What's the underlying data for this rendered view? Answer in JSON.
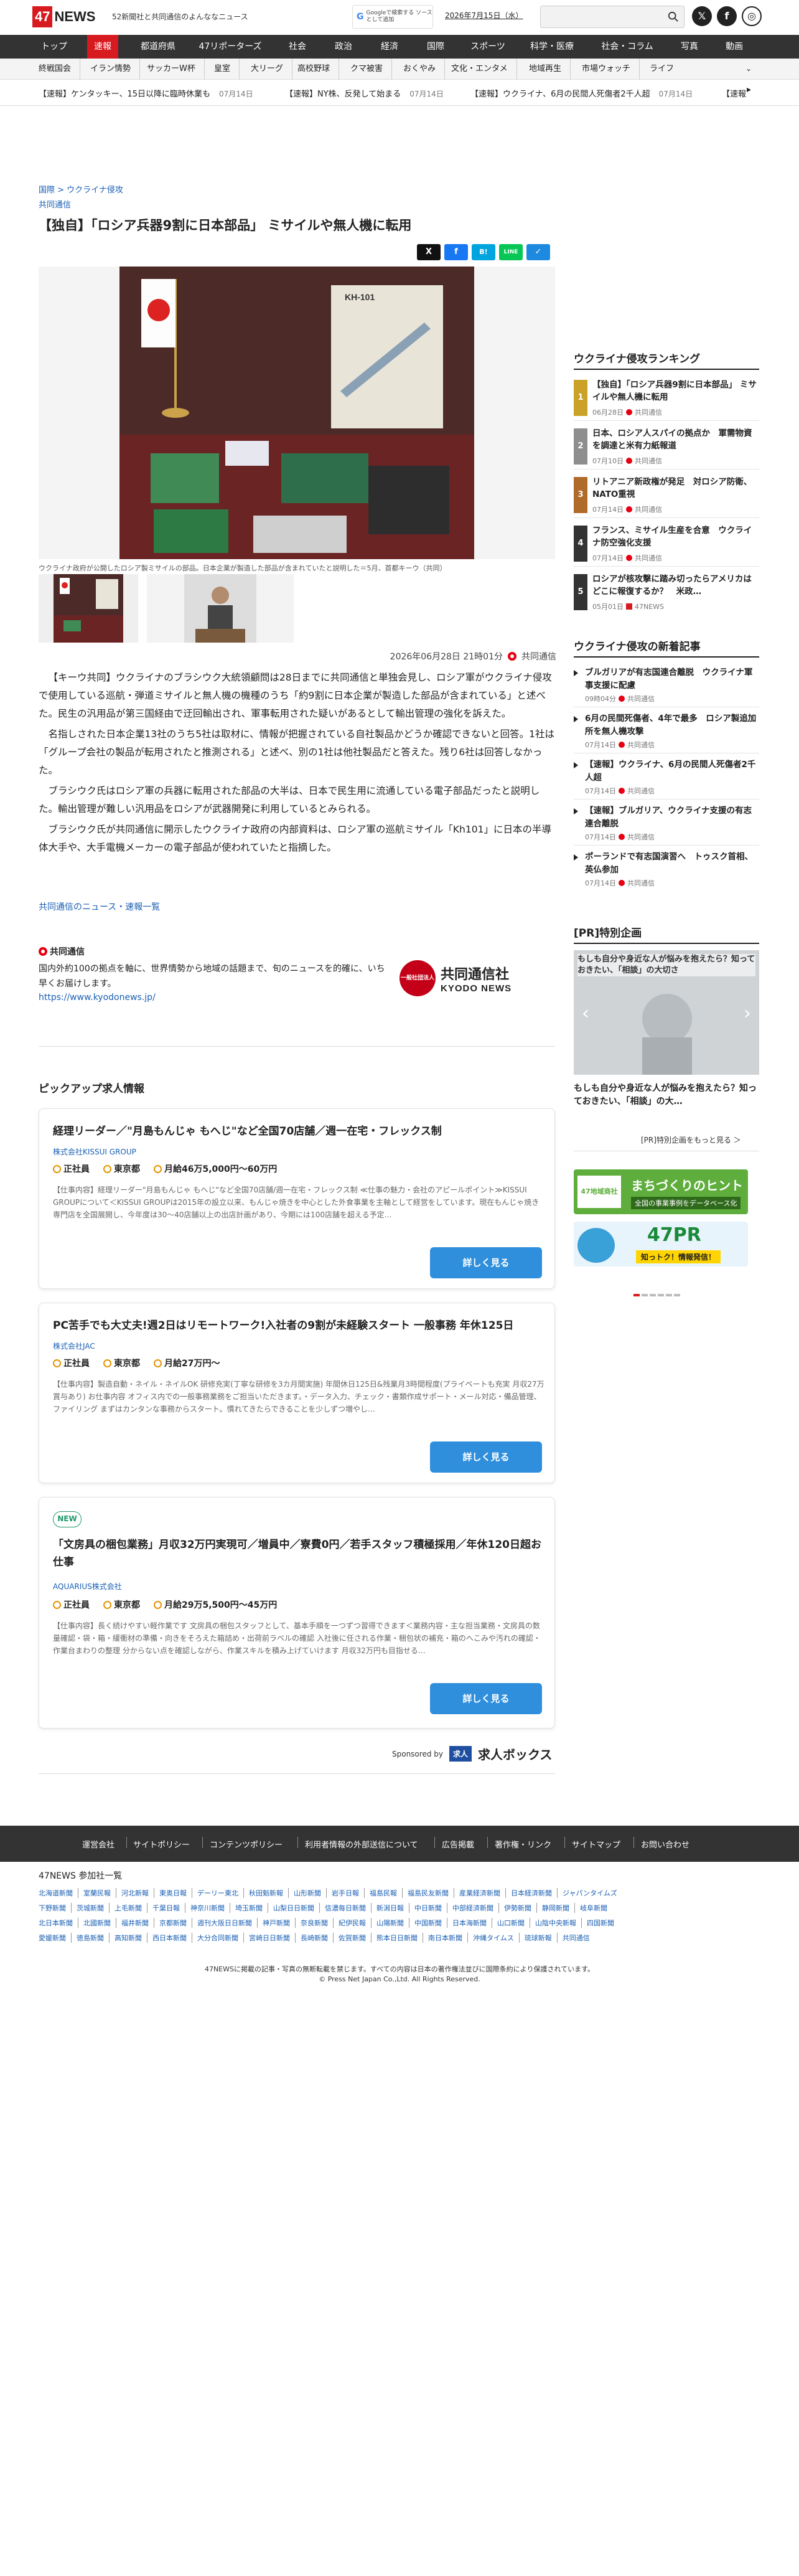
{
  "site": {
    "logo_num": "47",
    "logo_news": "NEWS",
    "tagline": "52新聞社と共同通信のよんななニュース",
    "google_label": "Googleで検索する ソースとして追加",
    "date": "2026年7月15日（水）",
    "search_placeholder": ""
  },
  "nav_main": [
    "トップ",
    "速報",
    "都道府県",
    "47リポーターズ",
    "社会",
    "政治",
    "経済",
    "国際",
    "スポーツ",
    "科学・医療",
    "社会・コラム",
    "写真",
    "動画"
  ],
  "nav_sub": [
    "終戦国会",
    "イラン情勢",
    "サッカーW杯",
    "皇室",
    "大リーグ",
    "高校野球",
    "クマ被害",
    "おくやみ",
    "文化・エンタメ",
    "地域再生",
    "市場ウォッチ",
    "ライフ"
  ],
  "ticker": [
    {
      "text": "【速報】ケンタッキー、15日以降に臨時休業も",
      "date": "07月14日"
    },
    {
      "text": "【速報】NY株、反発して始まる",
      "date": "07月14日"
    },
    {
      "text": "【速報】ウクライナ、6月の民間人死傷者2千人超",
      "date": "07月14日"
    },
    {
      "text": "【速報",
      "date": ""
    }
  ],
  "article": {
    "breadcrumb": "国際 > ウクライナ侵攻",
    "source": "共同通信",
    "title": "【独自】「ロシア兵器9割に日本部品」 ミサイルや無人機に転用",
    "caption": "ウクライナ政府が公開したロシア製ミサイルの部品。日本企業が製造した部品が含まれていたと説明した＝5月、首都キーウ（共同）",
    "image_label": "KH-101",
    "date": "2026年06月28日 21時01分",
    "publisher": "共同通信",
    "paragraphs": [
      "【キーウ共同】ウクライナのブラシウク大統領顧問は28日までに共同通信と単独会見し、ロシア軍がウクライナ侵攻で使用している巡航・弾道ミサイルと無人機の機種のうち「約9割に日本企業が製造した部品が含まれている」と述べた。民生の汎用品が第三国経由で迂回輸出され、軍事転用された疑いがあるとして輸出管理の強化を訴えた。",
      "名指しされた日本企業13社のうち5社は取材に、情報が把握されている自社製品かどうか確認できないと回答。1社は「グループ会社の製品が転用されたと推測される」と述べ、別の1社は他社製品だと答えた。残り6社は回答しなかった。",
      "ブラシウク氏はロシア軍の兵器に転用された部品の大半は、日本で民生用に流通している電子部品だったと説明した。輸出管理が難しい汎用品をロシアが武器開発に利用しているとみられる。",
      "ブラシウク氏が共同通信に開示したウクライナ政府の内部資料は、ロシア軍の巡航ミサイル「Kh101」に日本の半導体大手や、大手電機メーカーの電子部品が使われていたと指摘した。"
    ],
    "more_link": "共同通信のニュース・速報一覧"
  },
  "share": [
    "X",
    "f",
    "B!",
    "LINE",
    "✓"
  ],
  "publisher_box": {
    "name": "共同通信",
    "desc": "国内外約100の拠点を軸に、世界情勢から地域の話題まで、旬のニュースを的確に、いち早くお届けします。",
    "url": "https://www.kyodonews.jp/",
    "logo_circle": "一般社団法人",
    "logo_jp": "共同通信社",
    "logo_en": "KYODO NEWS"
  },
  "jobs": {
    "heading": "ピックアップ求人情報",
    "items": [
      {
        "new": "",
        "title": "経理リーダー／\"月島もんじゃ もへじ\"など全国70店舗／週一在宅・フレックス制",
        "company": "株式会社KISSUI GROUP",
        "type": "正社員",
        "place": "東京都",
        "salary": "月給46万5,000円〜60万円",
        "desc": "【仕事内容】経理リーダー\"月島もんじゃ もへじ\"など全国70店舗/週一在宅・フレックス制 ≪仕事の魅力・会社のアピールポイント≫KISSUI GROUPについて＜KISSUI GROUPは2015年の設立以来、もんじゃ焼きを中心とした外食事業を主軸として経営をしています。現在もんじゃ焼き専門店を全国展開し、今年度は30〜40店舗以上の出店計画があり、今期には100店舗を超える予定…",
        "button": "詳しく見る"
      },
      {
        "new": "",
        "title": "PC苦手でも大丈夫!週2日はリモートワーク!入社者の9割が未経験スタート 一般事務 年休125日",
        "company": "株式会社JAC",
        "type": "正社員",
        "place": "東京都",
        "salary": "月給27万円〜",
        "desc": "【仕事内容】製造自動・ネイル・ネイルOK 研修充実(丁寧な研修を3カ月間実施) 年間休日125日&残業月3時間程度(プライベートも充実 月収27万 賞与あり) お仕事内容 オフィス内での一般事務業務をご担当いただきます。・データ入力、チェック・書類作成サポート・メール対応・備品管理、ファイリング まずはカンタンな事務からスタート。慣れてきたらできることを少しずつ増やし…",
        "button": "詳しく見る"
      },
      {
        "new": "NEW",
        "title": "「文房具の梱包業務」月収32万円実現可／増員中／寮費0円／若手スタッフ積極採用／年休120日超お仕事",
        "company": "AQUARIUS株式会社",
        "type": "正社員",
        "place": "東京都",
        "salary": "月給29万5,500円〜45万円",
        "desc": "【仕事内容】長く続けやすい軽作業です 文房具の梱包スタッフとして、基本手順を一つずつ習得できます＜業務内容・主な担当業務・文房具の数量確認・袋・箱・緩衝材の準備・向きをそろえた箱詰め・出荷前ラベルの確認 入社後に任される作業・梱包状の補充・箱のへこみや汚れの確認・作業台まわりの整理 分からない点を確認しながら、作業スキルを積み上げていけます 月収32万円も目指せる…",
        "button": "詳しく見る"
      }
    ],
    "sponsor_label": "Sponsored by",
    "sponsor_badge": "求人",
    "sponsor_name": "求人ボックス"
  },
  "ranking": {
    "heading": "ウクライナ侵攻ランキング",
    "items": [
      {
        "no": "1",
        "title": "【独自】「ロシア兵器9割に日本部品」 ミサイルや無人機に転用",
        "date": "06月28日",
        "src": "共同通信"
      },
      {
        "no": "2",
        "title": "日本、ロシア人スパイの拠点か　軍需物資を調達と米有力紙報道",
        "date": "07月10日",
        "src": "共同通信"
      },
      {
        "no": "3",
        "title": "リトアニア新政権が発足　対ロシア防衛、NATO重視",
        "date": "07月14日",
        "src": "共同通信"
      },
      {
        "no": "4",
        "title": "フランス、ミサイル生産を合意　ウクライナ防空強化支援",
        "date": "07月14日",
        "src": "共同通信"
      },
      {
        "no": "5",
        "title": "ロシアが核攻撃に踏み切ったらアメリカはどこに報復するか？　米政…",
        "date": "05月01日",
        "src": "47NEWS"
      }
    ]
  },
  "latest": {
    "heading": "ウクライナ侵攻の新着記事",
    "items": [
      {
        "title": "ブルガリアが有志国連合離脱　ウクライナ軍事支援に配慮",
        "date": "09時04分",
        "src": "共同通信"
      },
      {
        "title": "6月の民間死傷者、4年で最多　ロシア製追加所を無人機攻撃",
        "date": "07月14日",
        "src": "共同通信"
      },
      {
        "title": "【速報】ウクライナ、6月の民間人死傷者2千人超",
        "date": "07月14日",
        "src": "共同通信"
      },
      {
        "title": "【速報】ブルガリア、ウクライナ支援の有志連合離脱",
        "date": "07月14日",
        "src": "共同通信"
      },
      {
        "title": "ポーランドで有志国演習へ　トゥスク首相、英仏参加",
        "date": "07月14日",
        "src": "共同通信"
      }
    ]
  },
  "pr": {
    "heading": "[PR]特別企画",
    "slide_text": "もしも自分や身近な人が悩みを抱えたら？知っておきたい、「相談」の大切さ",
    "caption": "もしも自分や身近な人が悩みを抱えたら？知っておきたい、「相談」の大…",
    "more": "[PR]特別企画をもっと見る ＞"
  },
  "banners": {
    "b1_title": "まちづくりのヒント",
    "b1_sub": "全国の事業事例をデータベース化",
    "b1_tag": "47地域商社",
    "b2_title": "47PR",
    "b2_sub": "知っトク！情報発信！"
  },
  "footer": {
    "links": [
      "運営会社",
      "サイトポリシー",
      "コンテンツポリシー",
      "利用者情報の外部送信について",
      "広告掲載",
      "著作権・リンク",
      "サイトマップ",
      "お問い合わせ"
    ],
    "partners_heading": "47NEWS 参加社一覧",
    "partner_rows": [
      [
        "北海道新聞",
        "室蘭民報",
        "河北新報",
        "東奥日報",
        "デーリー東北",
        "秋田魁新報",
        "山形新聞",
        "岩手日報",
        "福島民報",
        "福島民友新聞",
        "産業経済新聞",
        "日本経済新聞",
        "ジャパンタイムズ"
      ],
      [
        "下野新聞",
        "茨城新聞",
        "上毛新聞",
        "千葉日報",
        "神奈川新聞",
        "埼玉新聞",
        "山梨日日新聞",
        "信濃毎日新聞",
        "新潟日報",
        "中日新聞",
        "中部経済新聞",
        "伊勢新聞",
        "静岡新聞",
        "岐阜新聞"
      ],
      [
        "北日本新聞",
        "北國新聞",
        "福井新聞",
        "京都新聞",
        "週刊大阪日日新聞",
        "神戸新聞",
        "奈良新聞",
        "紀伊民報",
        "山陽新聞",
        "中国新聞",
        "日本海新聞",
        "山口新聞",
        "山陰中央新報",
        "四国新聞"
      ],
      [
        "愛媛新聞",
        "徳島新聞",
        "高知新聞",
        "西日本新聞",
        "大分合同新聞",
        "宮崎日日新聞",
        "長崎新聞",
        "佐賀新聞",
        "熊本日日新聞",
        "南日本新聞",
        "沖縄タイムス",
        "琉球新報",
        "共同通信"
      ]
    ],
    "copyright1": "47NEWSに掲載の記事・写真の無断転載を禁じます。すべての内容は日本の著作権法並びに国際条約により保護されています。",
    "copyright2": "© Press Net Japan Co.,Ltd. All Rights Reserved."
  },
  "colors": {
    "accent": "#d71920",
    "nav_dark": "#333333",
    "link": "#1a5fb4",
    "button": "#2f8fdd"
  }
}
